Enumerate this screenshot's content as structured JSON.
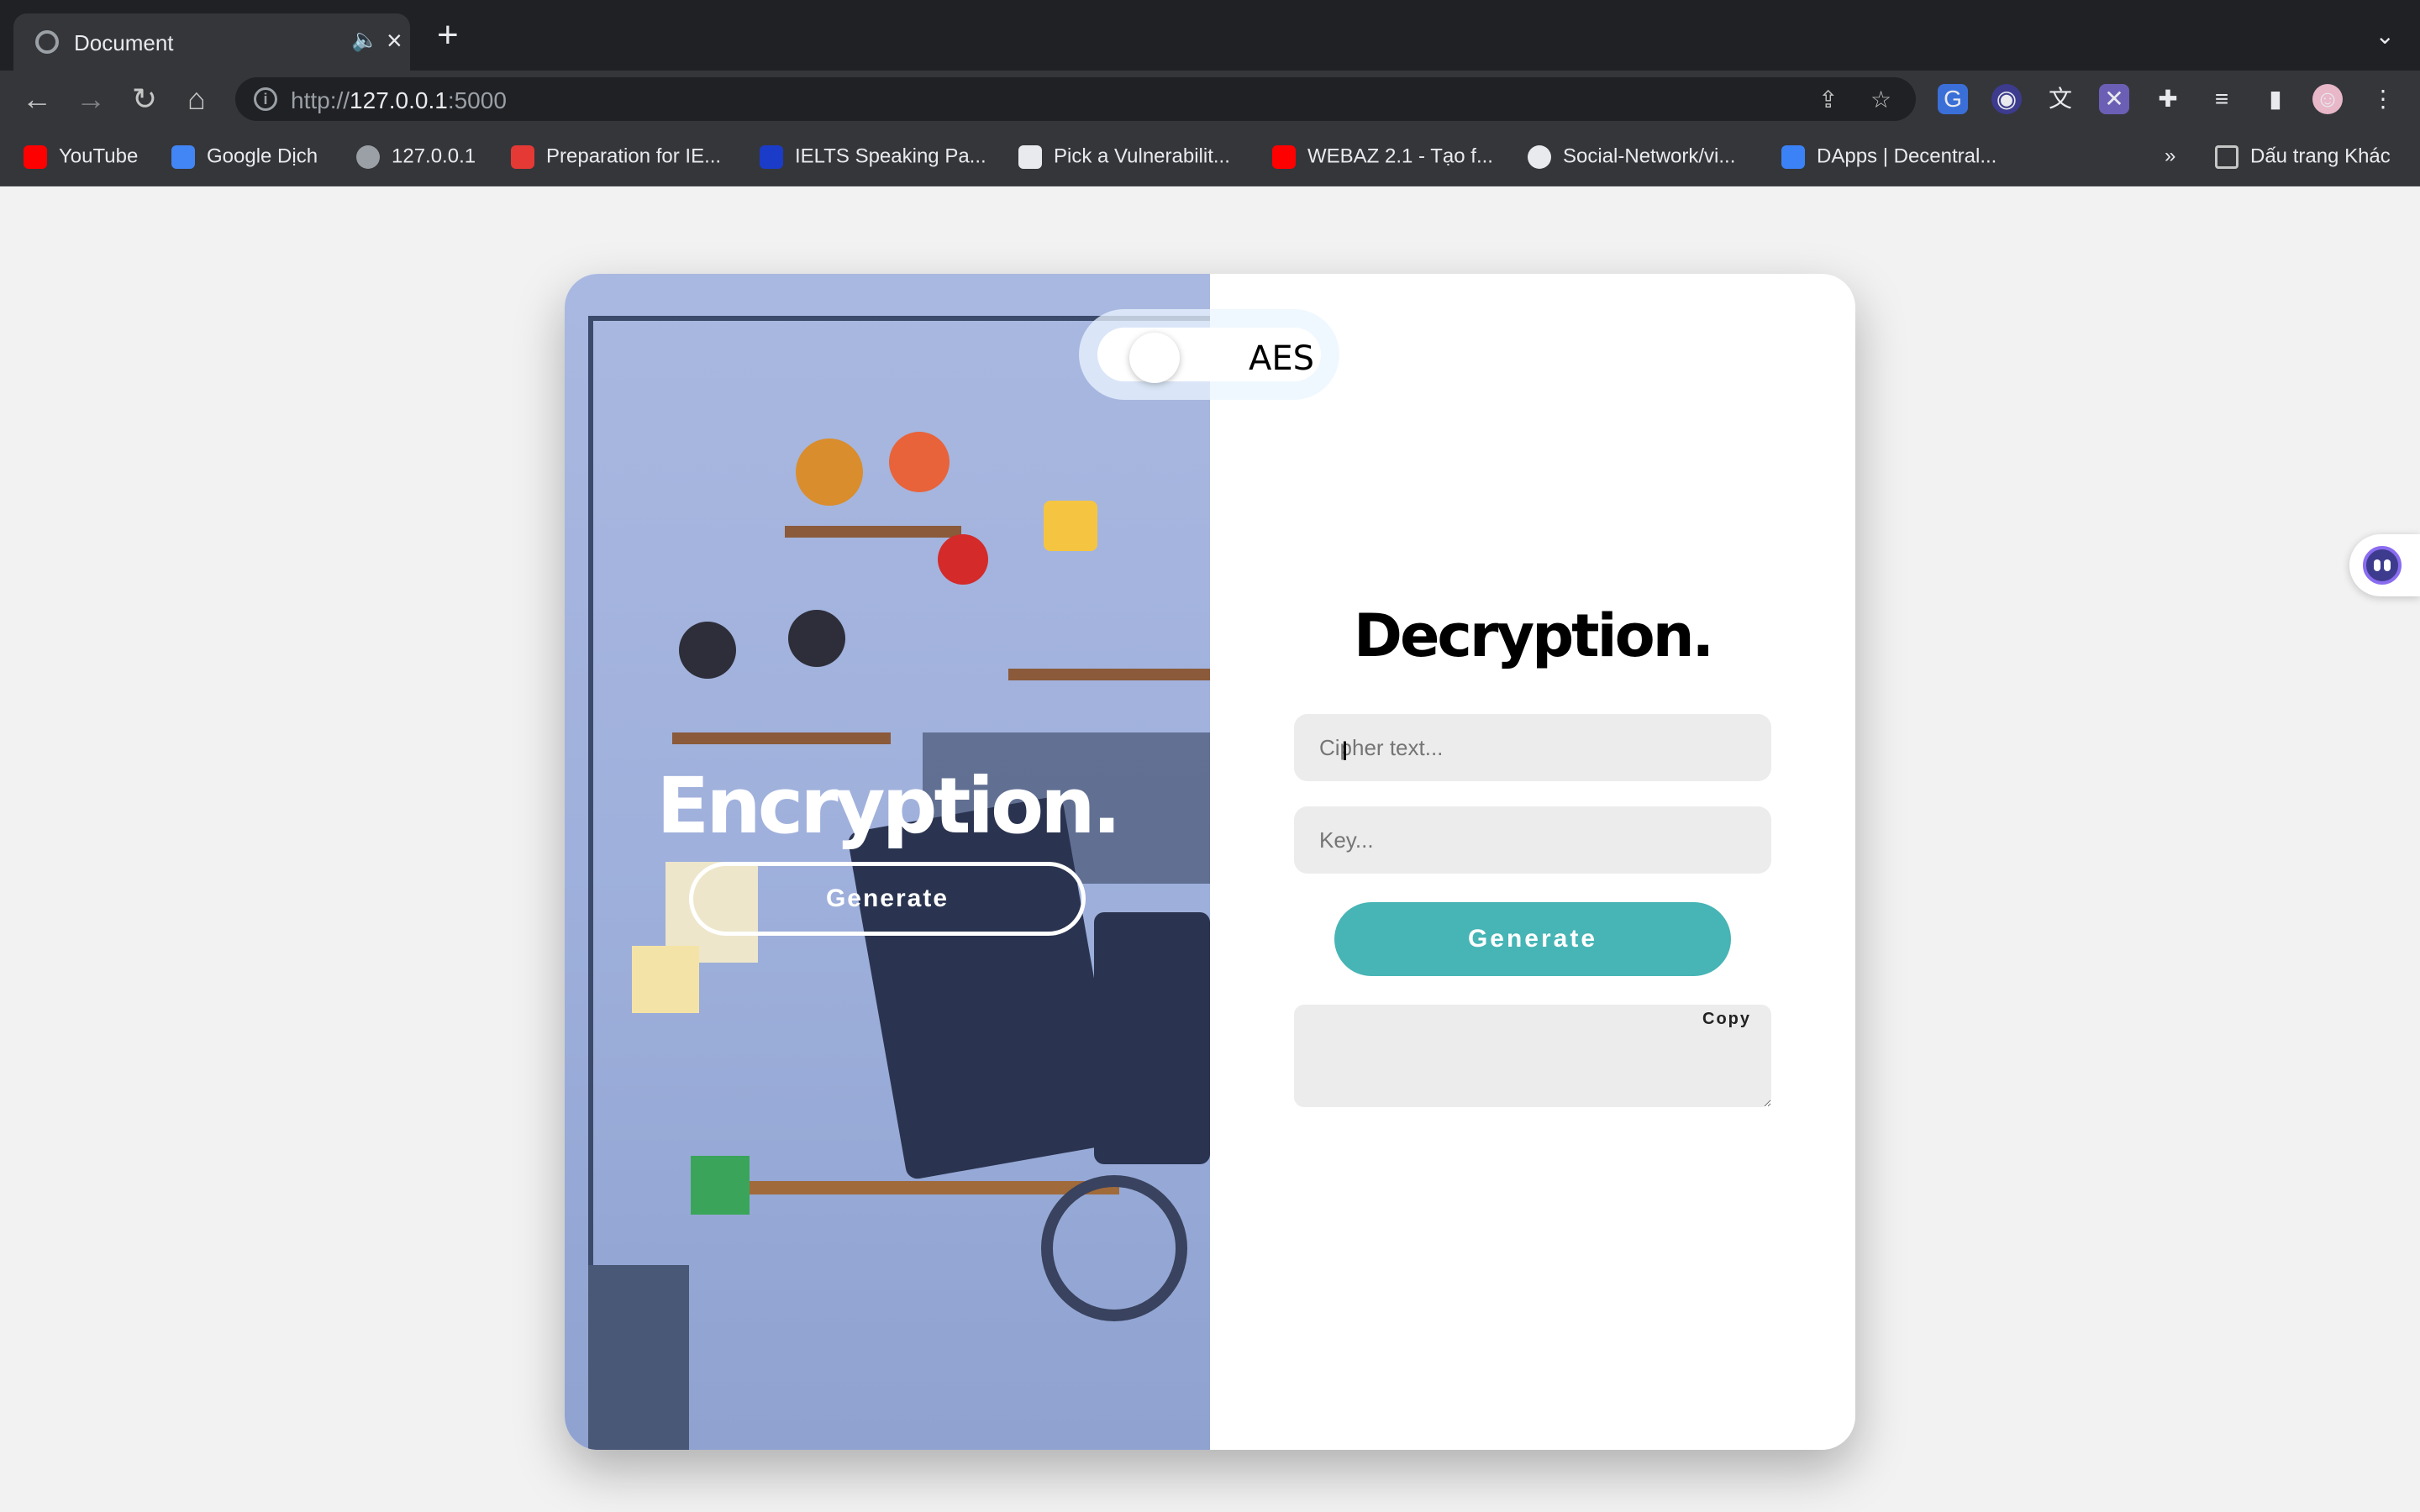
{
  "browser": {
    "tab_title": "Document",
    "url_scheme": "http://",
    "url_host": "127.0.0.1",
    "url_port": ":5000",
    "bookmarks": [
      {
        "label": "YouTube",
        "icon": "youtube-icon",
        "color": "#ff0000"
      },
      {
        "label": "Google Dịch",
        "icon": "google-translate-icon",
        "color": "#4285f4"
      },
      {
        "label": "127.0.0.1",
        "icon": "globe-icon",
        "color": "#9aa0a6"
      },
      {
        "label": "Preparation for IE...",
        "icon": "preparation-icon",
        "color": "#e53935"
      },
      {
        "label": "IELTS Speaking Pa...",
        "icon": "ielts-icon",
        "color": "#1a3cc8"
      },
      {
        "label": "Pick a Vulnerabilit...",
        "icon": "hackerone-icon",
        "color": "#e8eaed"
      },
      {
        "label": "WEBAZ 2.1 - Tạo f...",
        "icon": "youtube-icon",
        "color": "#ff0000"
      },
      {
        "label": "Social-Network/vi...",
        "icon": "github-icon",
        "color": "#e8eaed"
      },
      {
        "label": "DApps | Decentral...",
        "icon": "shield-icon",
        "color": "#3b82f6"
      }
    ],
    "more_bookmarks": "»",
    "other_bookmarks": "Dấu trang Khác"
  },
  "page": {
    "mode_label": "AES",
    "encryption_title": "Encryption.",
    "encryption_button": "Generate",
    "decryption_title": "Decryption.",
    "cipher_placeholder": "Cipher text...",
    "key_placeholder": "Key...",
    "generate_label": "Generate",
    "copy_label": "Copy",
    "accent_color": "#47b4b5"
  }
}
